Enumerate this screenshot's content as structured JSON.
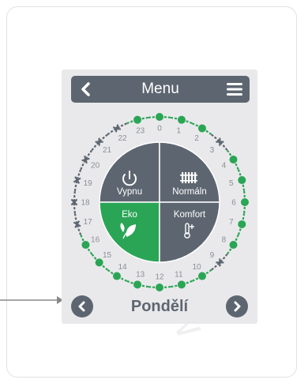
{
  "header": {
    "title": "Menu"
  },
  "modes": [
    {
      "key": "off",
      "label": "Vypnu",
      "icon": "power-icon",
      "active": false
    },
    {
      "key": "normal",
      "label": "Normáln",
      "icon": "radiator-icon",
      "active": false
    },
    {
      "key": "eco",
      "label": "Eko",
      "icon": "leaf-icon",
      "active": true
    },
    {
      "key": "comfort",
      "label": "Komfort",
      "icon": "thermometer-plus-icon",
      "active": false
    }
  ],
  "dial": {
    "hours": [
      "0",
      "1",
      "2",
      "3",
      "4",
      "5",
      "6",
      "7",
      "8",
      "9",
      "10",
      "11",
      "12",
      "13",
      "14",
      "15",
      "16",
      "17",
      "18",
      "19",
      "20",
      "21",
      "22",
      "23"
    ],
    "eco_hours": [
      0,
      1,
      2,
      4,
      5,
      6,
      7,
      8,
      10,
      11,
      12,
      13,
      14,
      15,
      16,
      23
    ]
  },
  "day": {
    "label": "Pondělí"
  },
  "colors": {
    "panel": "#5d6670",
    "eco": "#2aa555",
    "ring_grey": "#5d6670",
    "background": "#e9e9eb"
  },
  "watermark": "WWW"
}
